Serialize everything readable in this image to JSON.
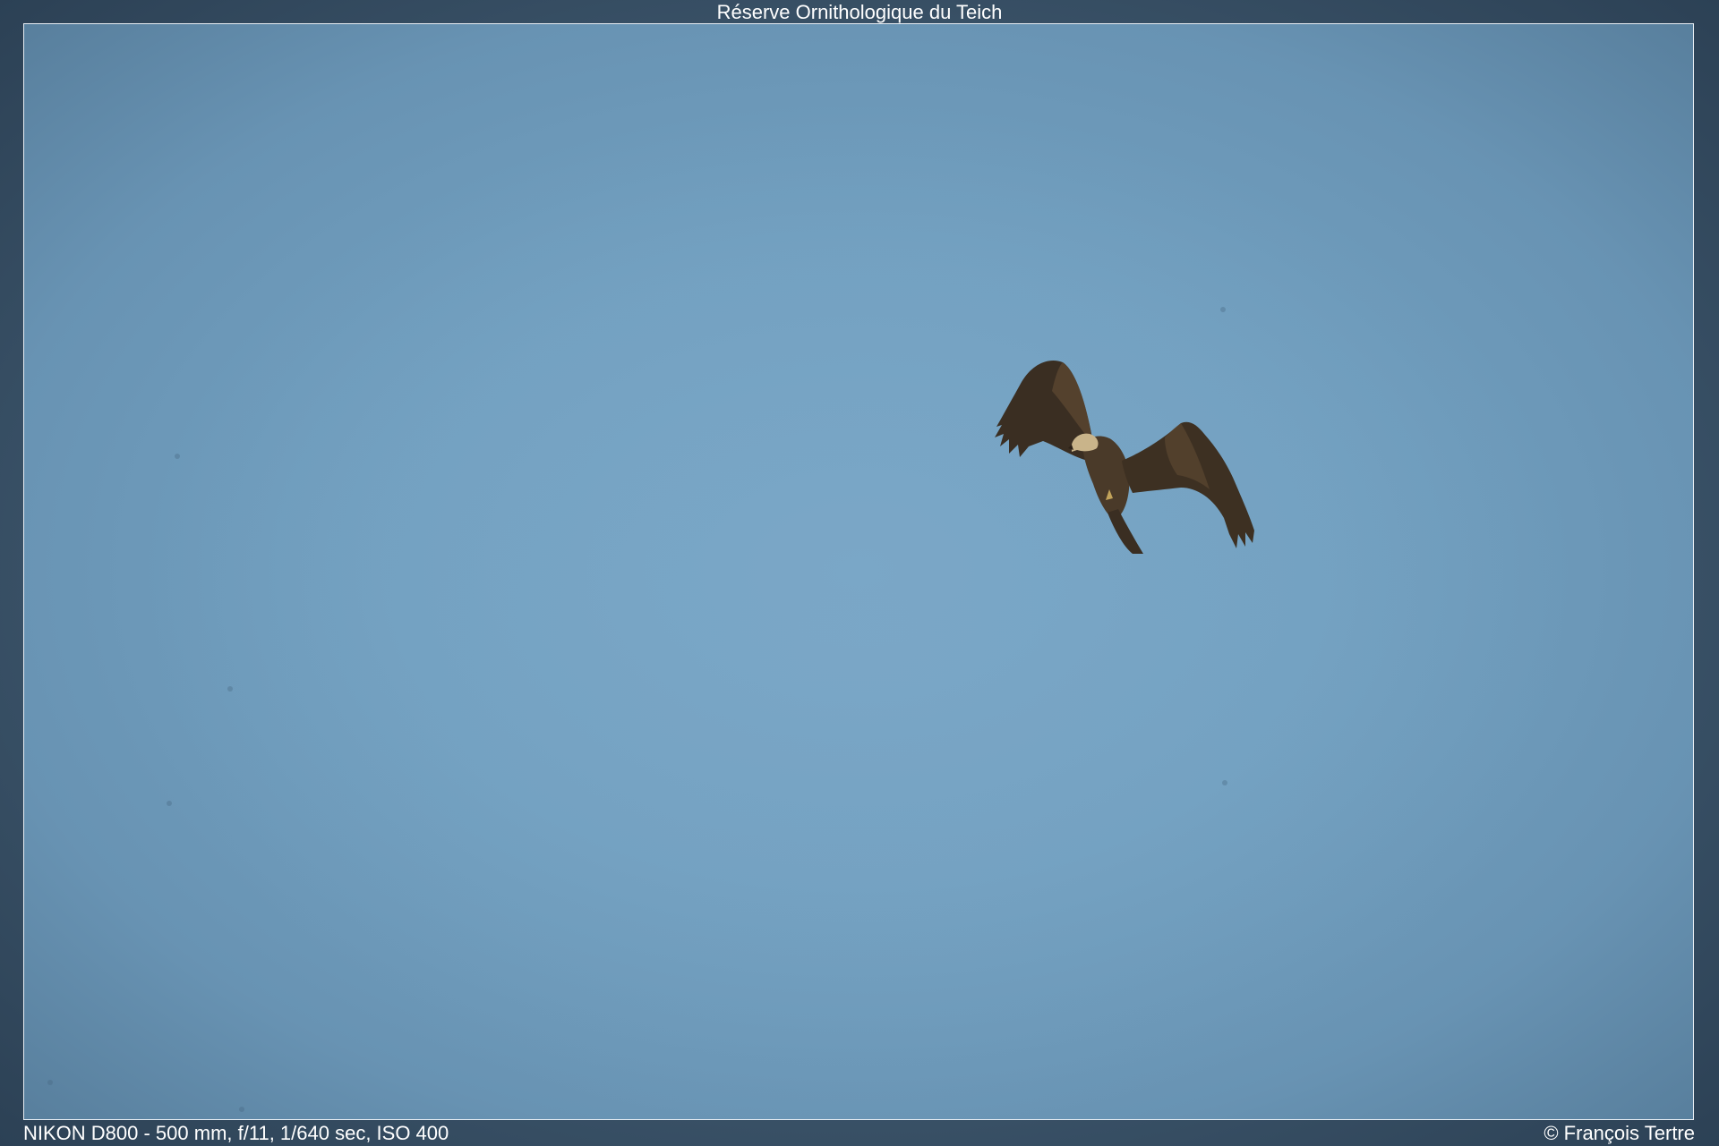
{
  "header": {
    "title": "Réserve Ornithologique du Teich"
  },
  "footer": {
    "exif": "NIKON D800 - 500 mm, f/11, 1/640 sec, ISO 400",
    "copyright": "© François Tertre"
  },
  "photo": {
    "subject": "raptor in flight",
    "sky_color": "#74a2c2",
    "border_color": "#e8eef4"
  }
}
